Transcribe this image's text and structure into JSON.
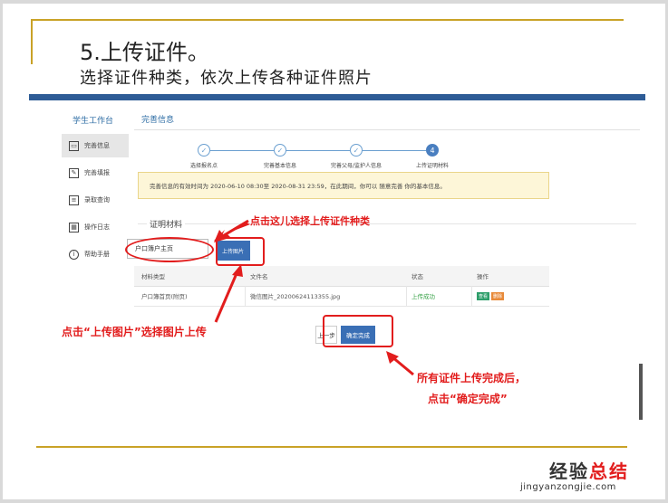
{
  "slide": {
    "title": "5.上传证件。",
    "subtitle": "选择证件种类，依次上传各种证件照片"
  },
  "sidebar": {
    "title": "学生工作台",
    "items": [
      {
        "label": "完善信息",
        "icon": "id-card-icon",
        "active": true
      },
      {
        "label": "完善填报",
        "icon": "document-edit-icon",
        "active": false
      },
      {
        "label": "录取查询",
        "icon": "document-search-icon",
        "active": false
      },
      {
        "label": "操作日志",
        "icon": "calendar-log-icon",
        "active": false
      },
      {
        "label": "帮助手册",
        "icon": "info-icon",
        "active": false
      }
    ]
  },
  "main": {
    "title": "完善信息",
    "steps": [
      {
        "label": "选择报名点",
        "state": "done"
      },
      {
        "label": "完善基本信息",
        "state": "done"
      },
      {
        "label": "完善父母/监护人信息",
        "state": "done"
      },
      {
        "label": "上传证明材料",
        "state": "current",
        "number": "4"
      }
    ],
    "notice": "完善信息的有效时间为 2020-06-10 08:30至 2020-08-31 23:59，在此期间，你可以 随意完善 你的基本信息。",
    "section_label": "证明材料",
    "doc_type_value": "户口簿户主页",
    "upload_button": "上传图片",
    "table": {
      "headers": [
        "材料类型",
        "文件名",
        "状态",
        "操作"
      ],
      "rows": [
        {
          "type": "户口簿首页(附页)",
          "filename": "微信图片_20200624113355.jpg",
          "status": "上传成功",
          "actions": [
            "查看",
            "删除"
          ]
        }
      ]
    },
    "prev_button": "上一步",
    "confirm_button": "确定完成"
  },
  "annotations": {
    "select_type": "点击这儿选择上传证件种类",
    "upload_image": "点击“上传图片”选择图片上传",
    "finish_line1": "所有证件上传完成后，",
    "finish_line2": "点击“确定完成”"
  },
  "watermark": {
    "main_part1": "经验",
    "main_part2": "总结",
    "url": "jingyanzongjie.com"
  },
  "colors": {
    "accent_blue": "#3a6fb5",
    "band_blue": "#2e5c96",
    "gold": "#c9a227",
    "annotation_red": "#e21d1d",
    "notice_bg": "#fdf6d8",
    "success_green": "#3aa34a"
  }
}
